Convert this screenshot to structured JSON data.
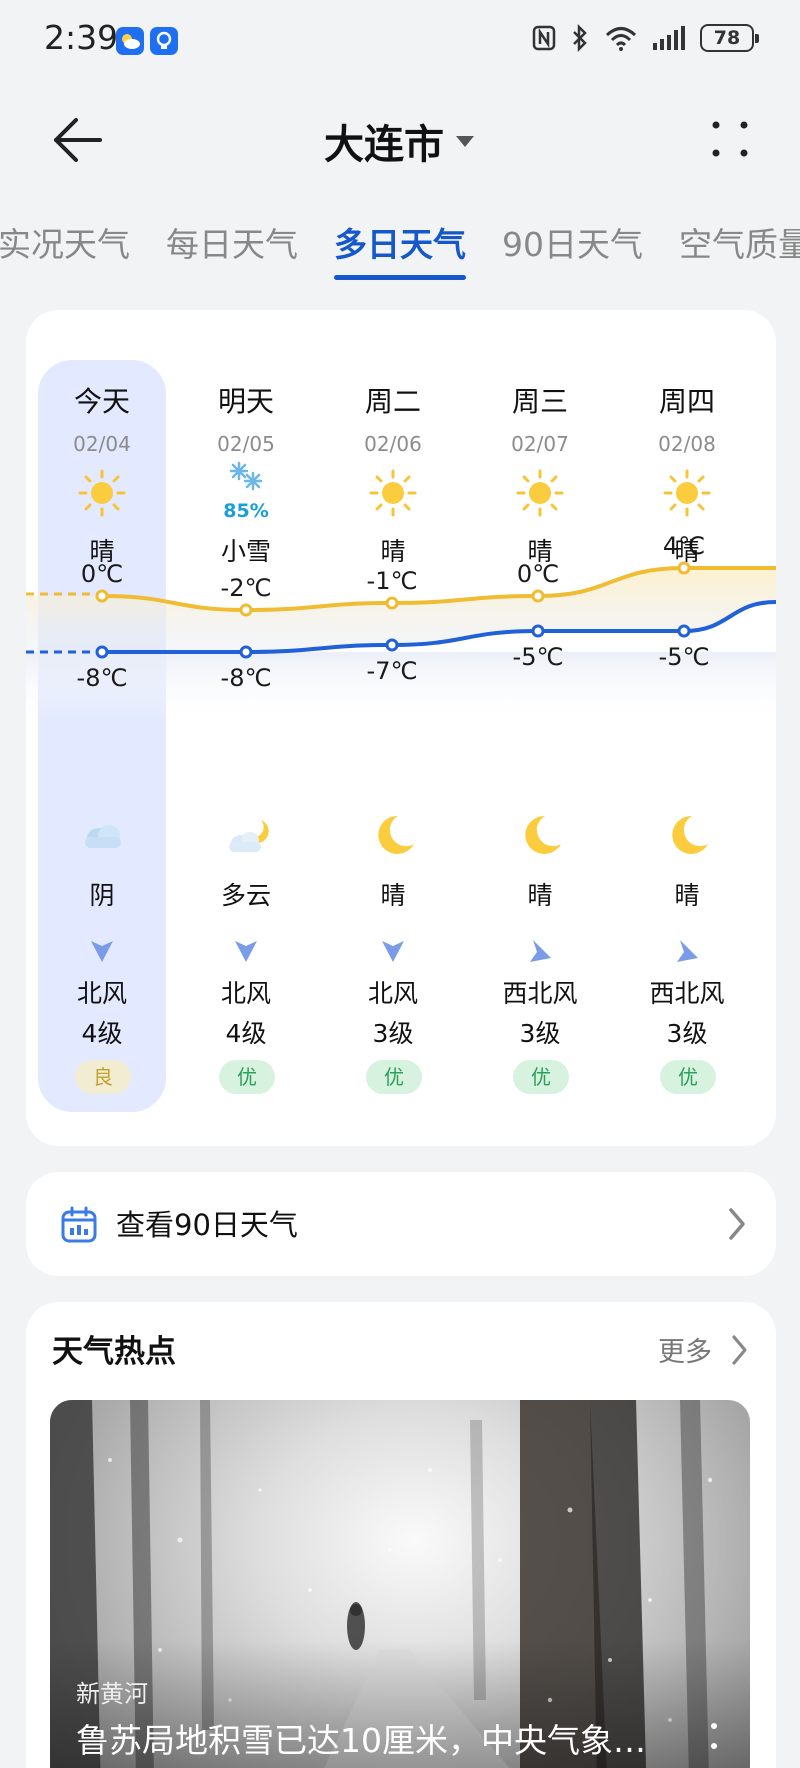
{
  "status_bar": {
    "time": "2:39",
    "battery": "78"
  },
  "header": {
    "city": "大连市"
  },
  "tabs": [
    {
      "label": "实况天气",
      "active": false
    },
    {
      "label": "每日天气",
      "active": false
    },
    {
      "label": "多日天气",
      "active": true
    },
    {
      "label": "90日天气",
      "active": false
    },
    {
      "label": "空气质量",
      "active": false
    }
  ],
  "forecast": {
    "days": [
      {
        "name": "今天",
        "date": "02/04",
        "day_icon": "sun-icon",
        "day_cond": "晴",
        "precip": "",
        "high": "0℃",
        "low": "-8℃",
        "night_icon": "cloud-icon",
        "night_cond": "阴",
        "wind_icon": "wind-north-icon",
        "wind_dir": "北风",
        "wind_level": "4级",
        "aqi": "良"
      },
      {
        "name": "明天",
        "date": "02/05",
        "day_icon": "snow-icon",
        "day_cond": "小雪",
        "precip": "85%",
        "high": "-2℃",
        "low": "-8℃",
        "night_icon": "cloudy-moon-icon",
        "night_cond": "多云",
        "wind_icon": "wind-north-icon",
        "wind_dir": "北风",
        "wind_level": "4级",
        "aqi": "优"
      },
      {
        "name": "周二",
        "date": "02/06",
        "day_icon": "sun-icon",
        "day_cond": "晴",
        "precip": "",
        "high": "-1℃",
        "low": "-7℃",
        "night_icon": "moon-icon",
        "night_cond": "晴",
        "wind_icon": "wind-north-icon",
        "wind_dir": "北风",
        "wind_level": "3级",
        "aqi": "优"
      },
      {
        "name": "周三",
        "date": "02/07",
        "day_icon": "sun-icon",
        "day_cond": "晴",
        "precip": "",
        "high": "0℃",
        "low": "-5℃",
        "night_icon": "moon-icon",
        "night_cond": "晴",
        "wind_icon": "wind-northwest-icon",
        "wind_dir": "西北风",
        "wind_level": "3级",
        "aqi": "优"
      },
      {
        "name": "周四",
        "date": "02/08",
        "day_icon": "sun-icon",
        "day_cond": "晴",
        "precip": "",
        "high": "4℃",
        "low": "-5℃",
        "night_icon": "moon-icon",
        "night_cond": "晴",
        "wind_icon": "wind-northwest-icon",
        "wind_dir": "西北风",
        "wind_level": "3级",
        "aqi": "优"
      }
    ],
    "high_values": [
      0,
      -2,
      -1,
      0,
      4
    ],
    "low_values": [
      -8,
      -8,
      -7,
      -5,
      -5
    ],
    "colors": {
      "high_line": "#f0bc33",
      "low_line": "#2060d8",
      "highlight": "#e3e9fe"
    }
  },
  "ninety": {
    "label": "查看90日天气"
  },
  "hot": {
    "title": "天气热点",
    "more": "更多",
    "source": "新黄河",
    "headline": "鲁苏局地积雪已达10厘米，中央气象…"
  }
}
